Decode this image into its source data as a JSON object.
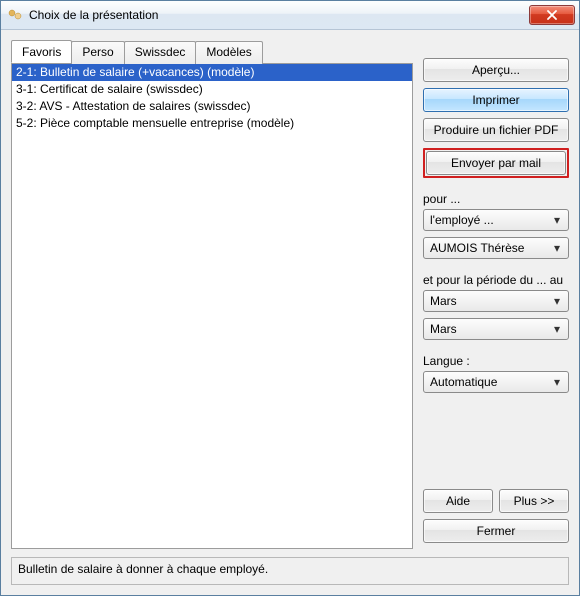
{
  "window": {
    "title": "Choix de la présentation"
  },
  "tabs": [
    {
      "label": "Favoris",
      "active": true
    },
    {
      "label": "Perso"
    },
    {
      "label": "Swissdec"
    },
    {
      "label": "Modèles"
    }
  ],
  "list_items": [
    {
      "text": "2-1: Bulletin de salaire (+vacances) (modèle)",
      "selected": true
    },
    {
      "text": "3-1: Certificat de salaire (swissdec)"
    },
    {
      "text": "3-2: AVS - Attestation de salaires (swissdec)"
    },
    {
      "text": "5-2: Pièce comptable mensuelle entreprise (modèle)"
    }
  ],
  "buttons": {
    "preview": "Aperçu...",
    "print": "Imprimer",
    "pdf": "Produire un fichier PDF",
    "email": "Envoyer par mail",
    "help": "Aide",
    "more": "Plus >>",
    "close": "Fermer"
  },
  "labels": {
    "for": "pour ...",
    "period": "et pour la période du ... au",
    "language": "Langue :"
  },
  "combos": {
    "target": "l'employé ...",
    "employee": "AUMOIS Thérèse",
    "period_from": "Mars",
    "period_to": "Mars",
    "language": "Automatique"
  },
  "footer_desc": "Bulletin de salaire à donner à chaque employé."
}
